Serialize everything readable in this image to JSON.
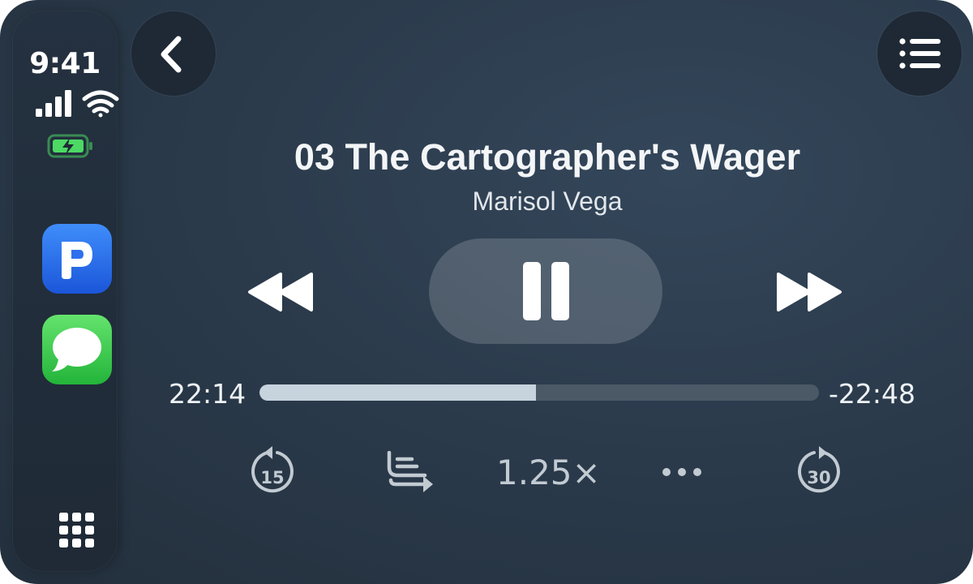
{
  "status_bar": {
    "time": "9:41",
    "signal_icon": "cellular-signal-icon",
    "wifi_icon": "wifi-icon",
    "battery_icon": "battery-charging-icon",
    "battery_color": "#4cd964"
  },
  "dock": {
    "apps": [
      {
        "name": "podcasts",
        "icon": "podcast-app-icon",
        "color": "#2f7cf6"
      },
      {
        "name": "messages",
        "icon": "messages-app-icon",
        "color": "#34c759"
      }
    ],
    "home_icon": "app-grid-icon"
  },
  "header": {
    "back_icon": "chevron-left-icon",
    "queue_icon": "list-icon"
  },
  "now_playing": {
    "title": "03 The Cartographer's Wager",
    "author": "Marisol Vega",
    "elapsed": "22:14",
    "remaining": "-22:48",
    "progress": 0.494,
    "playing": true
  },
  "transport": {
    "rewind_icon": "rewind-icon",
    "pause_icon": "pause-icon",
    "fast_forward_icon": "fast-forward-icon"
  },
  "controls": {
    "skip_back_label": "15",
    "skip_forward_label": "30",
    "speed": "1.25×",
    "next_chapter_icon": "next-chapter-icon",
    "more_icon": "more-icon"
  }
}
